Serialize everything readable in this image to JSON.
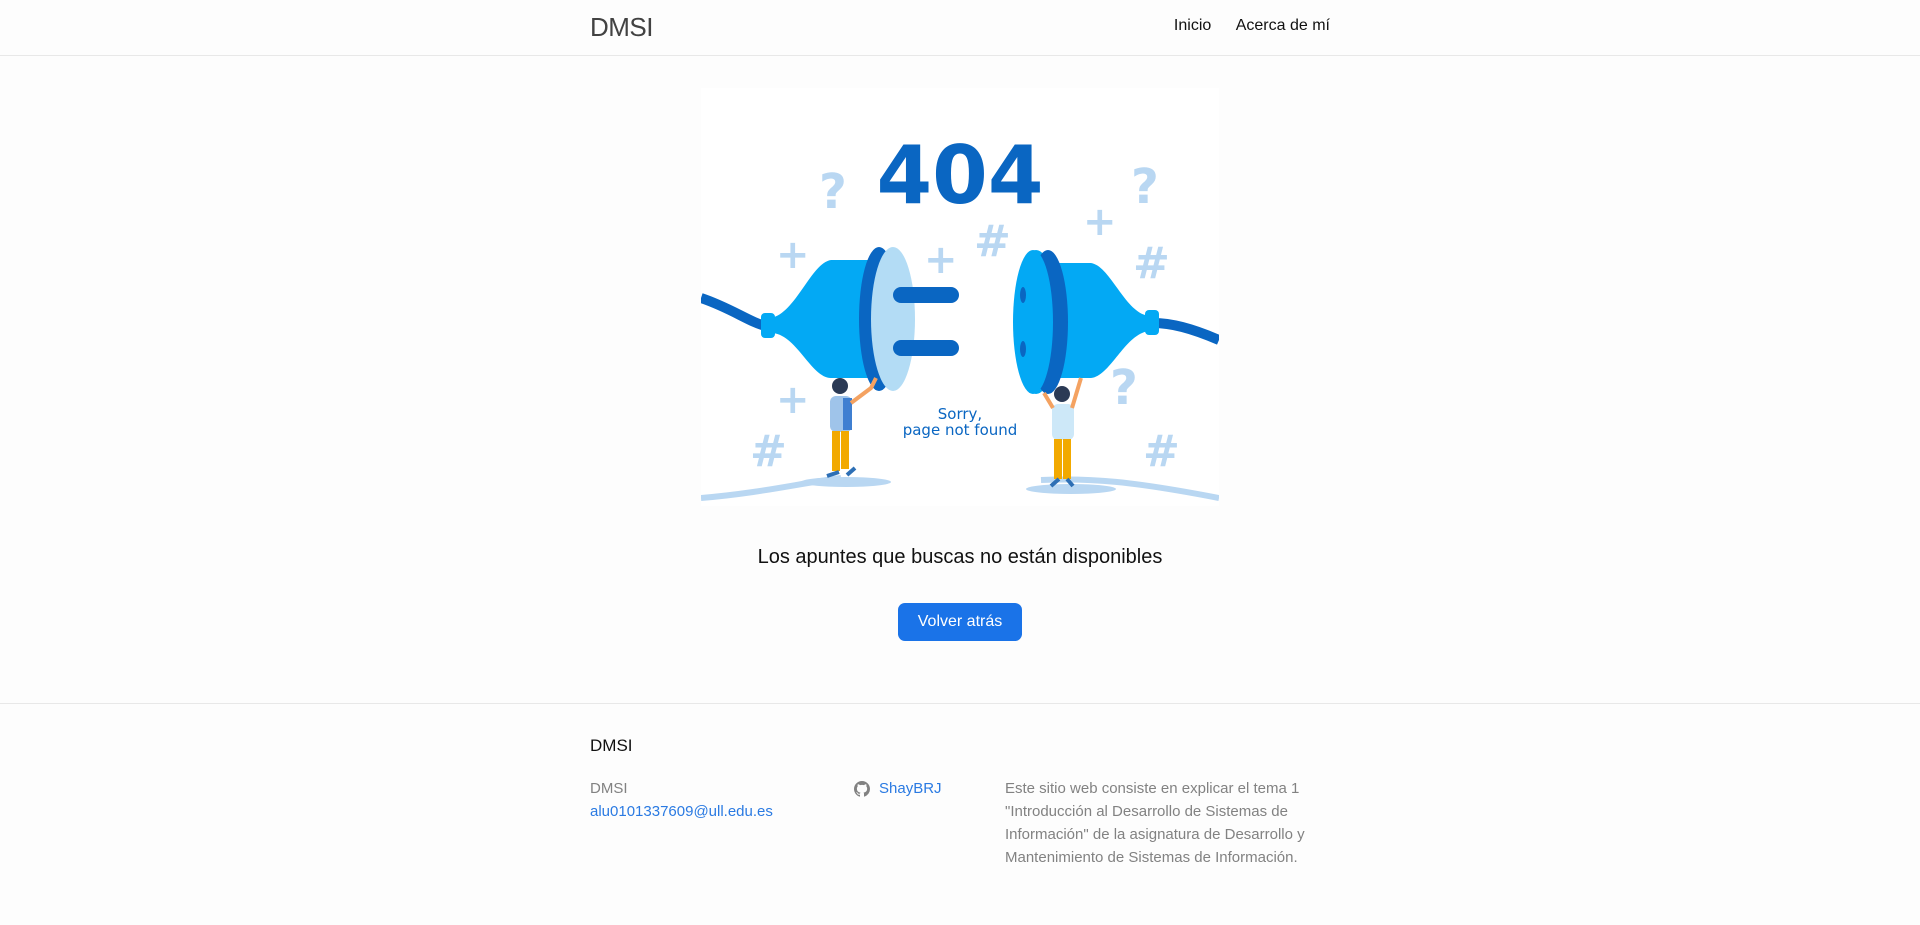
{
  "header": {
    "site_title": "DMSI",
    "nav": [
      "Inicio",
      "Acerca de mí"
    ]
  },
  "illustration": {
    "code": "404",
    "sorry_line1": "Sorry,",
    "sorry_line2": "page not found"
  },
  "main": {
    "message": "Los apuntes que buscas no están disponibles",
    "back_button": "Volver atrás"
  },
  "footer": {
    "heading": "DMSI",
    "name": "DMSI",
    "email": "alu0101337609@ull.edu.es",
    "github_user": "ShayBRJ",
    "description": "Este sitio web consiste en explicar el tema 1 \"Introducción al Desarrollo de Sistemas de Información\" de la asignatura de Desarrollo y Mantenimiento de Sistemas de Información."
  },
  "colors": {
    "accent": "#1a73e8",
    "link": "#2a7ae2",
    "illustration_dark_blue": "#0a66c2",
    "illustration_light_blue": "#03a9f4"
  }
}
